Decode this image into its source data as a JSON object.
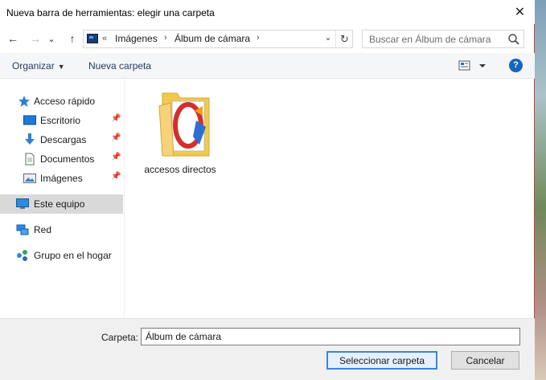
{
  "window": {
    "title": "Nueva barra de herramientas: elegir una carpeta",
    "close_glyph": "✕"
  },
  "nav": {
    "back_glyph": "←",
    "forward_glyph": "→",
    "recent_glyph": "⌄",
    "up_glyph": "↑"
  },
  "address": {
    "overflow": "«",
    "crumbs": [
      "Imágenes",
      "Álbum de cámara"
    ],
    "separator": "›",
    "dropdown_glyph": "⌄",
    "refresh_glyph": "↻"
  },
  "search": {
    "placeholder": "Buscar en Álbum de cámara"
  },
  "toolbar": {
    "organize_label": "Organizar",
    "new_folder_label": "Nueva carpeta",
    "help_label": "?"
  },
  "sidebar": {
    "items": [
      {
        "label": "Acceso rápido",
        "icon": "star-icon",
        "pinned": false
      },
      {
        "label": "Escritorio",
        "icon": "desktop-icon",
        "pinned": true
      },
      {
        "label": "Descargas",
        "icon": "download-icon",
        "pinned": true
      },
      {
        "label": "Documentos",
        "icon": "document-icon",
        "pinned": true
      },
      {
        "label": "Imágenes",
        "icon": "pictures-icon",
        "pinned": true
      },
      {
        "label": "Este equipo",
        "icon": "computer-icon",
        "pinned": false,
        "selected": true
      },
      {
        "label": "Red",
        "icon": "network-icon",
        "pinned": false
      },
      {
        "label": "Grupo en el hogar",
        "icon": "homegroup-icon",
        "pinned": false
      }
    ]
  },
  "content": {
    "items": [
      {
        "label": "accesos directos",
        "icon": "folder-icon"
      }
    ]
  },
  "footer": {
    "folder_label": "Carpeta:",
    "folder_value": "Álbum de cámara",
    "select_button": "Seleccionar carpeta",
    "cancel_button": "Cancelar"
  },
  "colors": {
    "accent": "#3c84d8",
    "selection": "#d9d9d9",
    "toolbar_bg": "#f5f6f7",
    "footer_bg": "#f0f0f0"
  }
}
